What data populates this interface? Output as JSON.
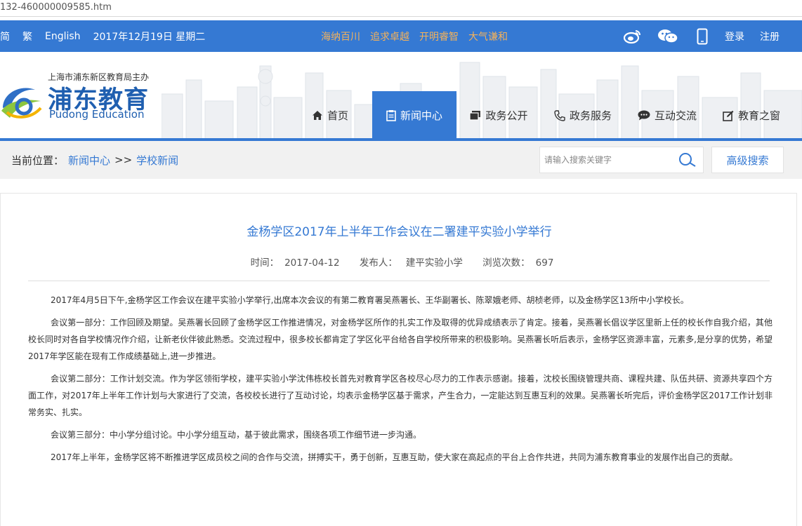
{
  "browser": {
    "address": "132-460000009585.htm"
  },
  "topbar": {
    "simplified": "简",
    "traditional": "繁",
    "english": "English",
    "date": "2017年12月19日 星期二",
    "slogans": [
      "海纳百川",
      "追求卓越",
      "开明睿智",
      "大气谦和"
    ],
    "login": "登录",
    "register": "注册",
    "icons": [
      "weibo-icon",
      "wechat-icon",
      "mobile-icon"
    ],
    "slogan_color": "#f5b25a",
    "bar_color": "#3579d3"
  },
  "logo": {
    "subtitle": "上海市浦东新区教育局主办",
    "name_cn": "浦东教育",
    "name_en": "Pudong Education"
  },
  "nav": [
    {
      "label": "首页",
      "icon": "home-icon"
    },
    {
      "label": "新闻中心",
      "icon": "document-icon",
      "active": true
    },
    {
      "label": "政务公开",
      "icon": "stack-icon"
    },
    {
      "label": "政务服务",
      "icon": "phone-icon"
    },
    {
      "label": "互动交流",
      "icon": "chat-bubble-icon"
    },
    {
      "label": "教育之窗",
      "icon": "edit-icon"
    }
  ],
  "breadcrumb": {
    "prefix": "当前位置：",
    "level1": "新闻中心",
    "separator": ">>",
    "level2": "学校新闻"
  },
  "search": {
    "placeholder": "请输入搜索关键字",
    "advanced": "高级搜索"
  },
  "article": {
    "title": "金杨学区2017年上半年工作会议在二署建平实验小学举行",
    "time_label": "时间：",
    "time": "2017-04-12",
    "publisher_label": "发布人：",
    "publisher": "建平实验小学",
    "views_label": "浏览次数：",
    "views": "697",
    "paragraphs": [
      "2017年4月5日下午,金杨学区工作会议在建平实验小学举行,出席本次会议的有第二教育署吴燕署长、王华副署长、陈翠娥老师、胡桢老师，以及金杨学区13所中小学校长。",
      "会议第一部分：工作回顾及期望。吴燕署长回顾了金杨学区工作推进情况，对金杨学区所作的扎实工作及取得的优异成绩表示了肯定。接着，吴燕署长倡议学区里新上任的校长作自我介绍，其他校长同时对各自学校情况作介绍，让新老伙伴彼此熟悉。交流过程中，很多校长都肯定了学区化平台给各自学校所带来的积极影响。吴燕署长听后表示，金杨学区资源丰富，元素多,是分享的优势，希望2017年学区能在现有工作成绩基础上,进一步推进。",
      "会议第二部分：工作计划交流。作为学区领衔学校，建平实验小学沈伟栋校长首先对教育学区各校尽心尽力的工作表示感谢。接着，沈校长围绕管理共商、课程共建、队伍共研、资源共享四个方面工作，对2017年上半年工作计划与大家进行了交流，各校校长进行了互动讨论，均表示金杨学区基于需求，产生合力，一定能达到互惠互利的效果。吴燕署长听完后，评价金杨学区2017工作计划非常务实、扎实。",
      "会议第三部分：中小学分组讨论。中小学分组互动，基于彼此需求，围绕各项工作细节进一步沟通。",
      "2017年上半年，金杨学区将不断推进学区成员校之间的合作与交流，拼搏实干，勇于创新，互惠互助，使大家在高起点的平台上合作共进，共同为浦东教育事业的发展作出自己的贡献。"
    ]
  }
}
